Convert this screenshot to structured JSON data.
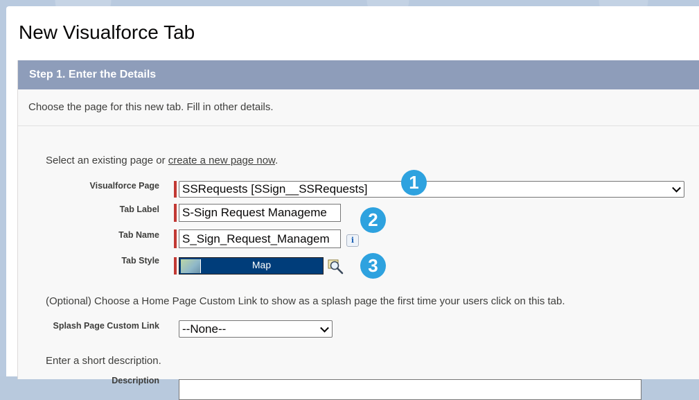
{
  "page": {
    "title": "New Visualforce Tab"
  },
  "step": {
    "header": "Step 1. Enter the Details",
    "subtitle": "Choose the page for this new tab. Fill in other details."
  },
  "intro": {
    "text_before_link": "Select an existing page or ",
    "link_text": "create a new page now",
    "text_after_link": "."
  },
  "fields": {
    "visualforce_page": {
      "label": "Visualforce Page",
      "value": "SSRequests [SSign__SSRequests]"
    },
    "tab_label": {
      "label": "Tab Label",
      "value": "S-Sign Request Manageme"
    },
    "tab_name": {
      "label": "Tab Name",
      "value": "S_Sign_Request_Managem"
    },
    "tab_style": {
      "label": "Tab Style",
      "value": "Map"
    }
  },
  "splash": {
    "text": "(Optional) Choose a Home Page Custom Link to show as a splash page the first time your users click on this tab.",
    "label": "Splash Page Custom Link",
    "value": "--None--"
  },
  "description": {
    "prompt": "Enter a short description.",
    "label": "Description"
  },
  "annotations": [
    "1",
    "2",
    "3"
  ],
  "colors": {
    "header_bg": "#8e9dba",
    "required_bar": "#c23934",
    "badge": "#2ea2df",
    "tab_style_bg": "#003d7a"
  }
}
